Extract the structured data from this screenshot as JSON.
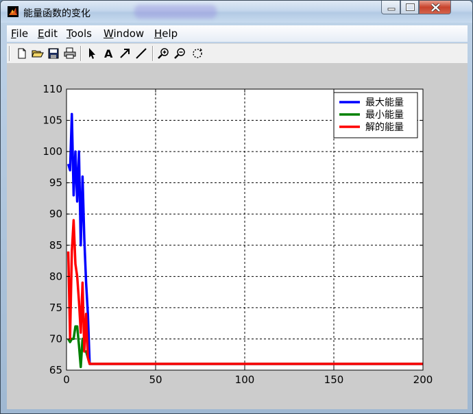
{
  "window": {
    "title": "能量函数的变化"
  },
  "menu": {
    "items": [
      {
        "key": "F",
        "rest": "ile"
      },
      {
        "key": "E",
        "rest": "dit"
      },
      {
        "key": "T",
        "rest": "ools"
      },
      {
        "key": "W",
        "rest": "indow"
      },
      {
        "key": "H",
        "rest": "elp"
      }
    ]
  },
  "toolbar": {
    "icons": [
      "new-file-icon",
      "open-folder-icon",
      "save-icon",
      "print-icon",
      "select-arrow-icon",
      "insert-text-icon",
      "insert-arrow-icon",
      "insert-line-icon",
      "zoom-in-icon",
      "zoom-out-icon",
      "rotate-icon"
    ]
  },
  "colors": {
    "max_energy": "#0000ff",
    "min_energy": "#008000",
    "solution_energy": "#ff0000"
  },
  "chart_data": {
    "type": "line",
    "title": "",
    "xlabel": "",
    "ylabel": "",
    "xlim": [
      0,
      200
    ],
    "ylim": [
      65,
      110
    ],
    "xticks": [
      "0",
      "50",
      "100",
      "150",
      "200"
    ],
    "yticks": [
      "65",
      "70",
      "75",
      "80",
      "85",
      "90",
      "95",
      "100",
      "105",
      "110"
    ],
    "grid": true,
    "legend_position": "top-right",
    "series": [
      {
        "name": "最大能量",
        "color": "#0000ff",
        "x": [
          1,
          2,
          3,
          4,
          5,
          6,
          7,
          8,
          9,
          10,
          11,
          12,
          13,
          200
        ],
        "y": [
          98,
          97,
          106,
          93,
          100,
          92,
          100,
          85,
          96,
          86,
          79,
          74,
          66,
          66
        ]
      },
      {
        "name": "最小能量",
        "color": "#008000",
        "x": [
          1,
          2,
          3,
          4,
          5,
          6,
          7,
          8,
          9,
          10,
          11,
          12,
          13,
          200
        ],
        "y": [
          70,
          69.5,
          70,
          70,
          72,
          72,
          69,
          65.5,
          70,
          68,
          68,
          67,
          66,
          66
        ]
      },
      {
        "name": "解的能量",
        "color": "#ff0000",
        "x": [
          1,
          2,
          3,
          4,
          5,
          6,
          7,
          8,
          9,
          10,
          11,
          12,
          13,
          200
        ],
        "y": [
          84,
          70,
          84,
          89,
          82,
          80,
          76,
          71,
          79,
          68,
          74,
          67,
          66,
          66
        ]
      }
    ]
  }
}
